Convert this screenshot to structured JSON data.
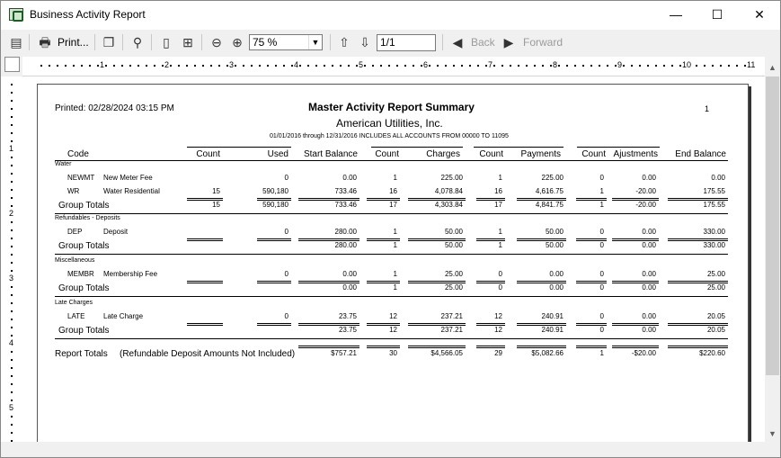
{
  "window": {
    "title": "Business Activity Report"
  },
  "toolbar": {
    "print_label": "Print...",
    "zoom_value": "75 %",
    "page_value": "1/1",
    "back_label": "Back",
    "forward_label": "Forward"
  },
  "ruler": {
    "h_numbers": [
      "1",
      "2",
      "3",
      "4",
      "5",
      "6",
      "7",
      "8",
      "9",
      "10",
      "11"
    ],
    "v_numbers": [
      "1",
      "2",
      "3",
      "4",
      "5"
    ]
  },
  "report": {
    "printed": "Printed: 02/28/2024 03:15 PM",
    "page_number": "1",
    "title": "Master Activity Report Summary",
    "company": "American Utilities, Inc.",
    "range": "01/01/2016 through 12/31/2016   INCLUDES ALL ACCOUNTS FROM 00000 TO 11095",
    "headers": [
      "Code",
      "Count",
      "Used",
      "Start Balance",
      "Count",
      "Charges",
      "Count",
      "Payments",
      "Count",
      "Ajustments",
      "End Balance"
    ],
    "sections": [
      {
        "name": "Water",
        "rows": [
          {
            "code": "NEWMT",
            "desc": "New Meter Fee",
            "cnt1": "",
            "used": "0",
            "start": "0.00",
            "cnt2": "1",
            "charges": "225.00",
            "cnt3": "1",
            "payments": "225.00",
            "cnt4": "0",
            "adj": "0.00",
            "end": "0.00"
          },
          {
            "code": "WR",
            "desc": "Water Residential",
            "cnt1": "15",
            "used": "590,180",
            "start": "733.46",
            "cnt2": "16",
            "charges": "4,078.84",
            "cnt3": "16",
            "payments": "4,616.75",
            "cnt4": "1",
            "adj": "-20.00",
            "end": "175.55"
          }
        ],
        "total_label": "Group Totals",
        "totals": {
          "cnt1": "15",
          "used": "590,180",
          "start": "733.46",
          "cnt2": "17",
          "charges": "4,303.84",
          "cnt3": "17",
          "payments": "4,841.75",
          "cnt4": "1",
          "adj": "-20.00",
          "end": "175.55"
        }
      },
      {
        "name": "Refundables - Deposits",
        "rows": [
          {
            "code": "DEP",
            "desc": "Deposit",
            "cnt1": "",
            "used": "0",
            "start": "280.00",
            "cnt2": "1",
            "charges": "50.00",
            "cnt3": "1",
            "payments": "50.00",
            "cnt4": "0",
            "adj": "0.00",
            "end": "330.00"
          }
        ],
        "total_label": "Group Totals",
        "totals": {
          "cnt1": "",
          "used": "",
          "start": "280.00",
          "cnt2": "1",
          "charges": "50.00",
          "cnt3": "1",
          "payments": "50.00",
          "cnt4": "0",
          "adj": "0.00",
          "end": "330.00"
        }
      },
      {
        "name": "Miscellaneous",
        "rows": [
          {
            "code": "MEMBR",
            "desc": "Membership Fee",
            "cnt1": "",
            "used": "0",
            "start": "0.00",
            "cnt2": "1",
            "charges": "25.00",
            "cnt3": "0",
            "payments": "0.00",
            "cnt4": "0",
            "adj": "0.00",
            "end": "25.00"
          }
        ],
        "total_label": "Group Totals",
        "totals": {
          "cnt1": "",
          "used": "",
          "start": "0.00",
          "cnt2": "1",
          "charges": "25.00",
          "cnt3": "0",
          "payments": "0.00",
          "cnt4": "0",
          "adj": "0.00",
          "end": "25.00"
        }
      },
      {
        "name": "Late Charges",
        "rows": [
          {
            "code": "LATE",
            "desc": "Late Charge",
            "cnt1": "",
            "used": "0",
            "start": "23.75",
            "cnt2": "12",
            "charges": "237.21",
            "cnt3": "12",
            "payments": "240.91",
            "cnt4": "0",
            "adj": "0.00",
            "end": "20.05"
          }
        ],
        "total_label": "Group Totals",
        "totals": {
          "cnt1": "",
          "used": "",
          "start": "23.75",
          "cnt2": "12",
          "charges": "237.21",
          "cnt3": "12",
          "payments": "240.91",
          "cnt4": "0",
          "adj": "0.00",
          "end": "20.05"
        }
      }
    ],
    "report_totals_label": "Report Totals",
    "report_totals_note": "(Refundable Deposit Amounts Not Included)",
    "report_totals": {
      "start": "$757.21",
      "cnt2": "30",
      "charges": "$4,566.05",
      "cnt3": "29",
      "payments": "$5,082.66",
      "cnt4": "1",
      "adj": "-$20.00",
      "end": "$220.60"
    }
  }
}
